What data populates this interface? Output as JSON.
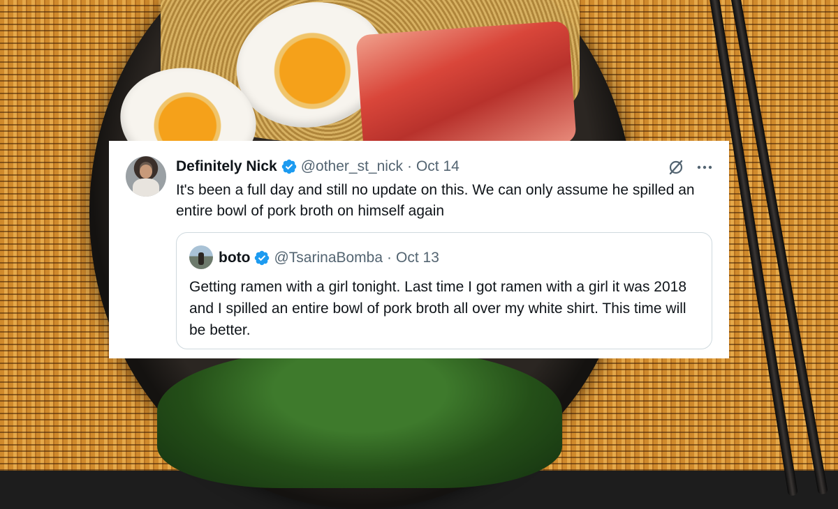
{
  "tweet": {
    "display_name": "Definitely Nick",
    "handle": "@other_st_nick",
    "separator": "·",
    "date": "Oct 14",
    "text": "It's been a full day and still no update on this. We can only assume he spilled an entire bowl of pork broth on himself again",
    "icons": [
      "grok-icon",
      "more-icon"
    ],
    "more_label": "···"
  },
  "quoted_tweet": {
    "display_name": "boto",
    "handle": "@TsarinaBomba",
    "separator": "·",
    "date": "Oct 13",
    "text": "Getting ramen with a girl tonight. Last time I got ramen with a girl it was 2018 and I spilled an entire bowl of pork broth all over my white shirt. This time will be better."
  },
  "colors": {
    "verified_badge": "#1d9bf0",
    "secondary_text": "#536471",
    "primary_text": "#0f1419",
    "border": "#cfd9de"
  }
}
